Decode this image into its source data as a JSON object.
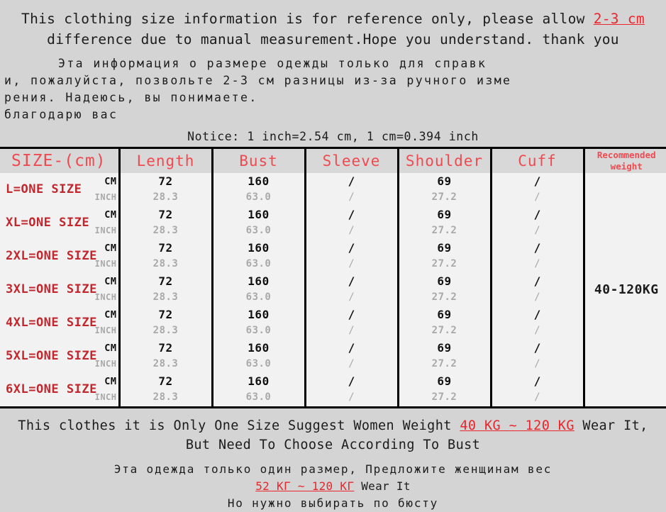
{
  "intro_en": {
    "text_before": "This clothing size information is for reference only, please allow ",
    "highlight": "2-3 cm",
    "text_after": " difference due to manual measurement.Hope you understand. thank you"
  },
  "intro_ru": {
    "line1": "Эта информация о размере одежды только для справк",
    "line2": "и, пожалуйста, позвольте 2-3 см разницы из-за ручного изме",
    "line3": "рения. Надеюсь, вы понимаете.",
    "line4": "благодарю вас"
  },
  "notice": "Notice: 1 inch=2.54 cm, 1 cm=0.394 inch",
  "table": {
    "headers": {
      "size": "SIZE-(cm)",
      "length": "Length",
      "bust": "Bust",
      "sleeve": "Sleeve",
      "shoulder": "Shoulder",
      "cuff": "Cuff",
      "weight_line1": "Recommended",
      "weight_line2": "weight"
    },
    "unit_cm": "CM",
    "unit_inch": "INCH",
    "weight_value": "40-120KG",
    "rows": [
      {
        "size": "L=ONE SIZE",
        "length_cm": "72",
        "length_inch": "28.3",
        "bust_cm": "160",
        "bust_inch": "63.0",
        "sleeve_cm": "/",
        "sleeve_inch": "/",
        "shoulder_cm": "69",
        "shoulder_inch": "27.2",
        "cuff_cm": "/",
        "cuff_inch": "/"
      },
      {
        "size": "XL=ONE SIZE",
        "length_cm": "72",
        "length_inch": "28.3",
        "bust_cm": "160",
        "bust_inch": "63.0",
        "sleeve_cm": "/",
        "sleeve_inch": "/",
        "shoulder_cm": "69",
        "shoulder_inch": "27.2",
        "cuff_cm": "/",
        "cuff_inch": "/"
      },
      {
        "size": "2XL=ONE SIZE",
        "length_cm": "72",
        "length_inch": "28.3",
        "bust_cm": "160",
        "bust_inch": "63.0",
        "sleeve_cm": "/",
        "sleeve_inch": "/",
        "shoulder_cm": "69",
        "shoulder_inch": "27.2",
        "cuff_cm": "/",
        "cuff_inch": "/"
      },
      {
        "size": "3XL=ONE SIZE",
        "length_cm": "72",
        "length_inch": "28.3",
        "bust_cm": "160",
        "bust_inch": "63.0",
        "sleeve_cm": "/",
        "sleeve_inch": "/",
        "shoulder_cm": "69",
        "shoulder_inch": "27.2",
        "cuff_cm": "/",
        "cuff_inch": "/"
      },
      {
        "size": "4XL=ONE SIZE",
        "length_cm": "72",
        "length_inch": "28.3",
        "bust_cm": "160",
        "bust_inch": "63.0",
        "sleeve_cm": "/",
        "sleeve_inch": "/",
        "shoulder_cm": "69",
        "shoulder_inch": "27.2",
        "cuff_cm": "/",
        "cuff_inch": "/"
      },
      {
        "size": "5XL=ONE SIZE",
        "length_cm": "72",
        "length_inch": "28.3",
        "bust_cm": "160",
        "bust_inch": "63.0",
        "sleeve_cm": "/",
        "sleeve_inch": "/",
        "shoulder_cm": "69",
        "shoulder_inch": "27.2",
        "cuff_cm": "/",
        "cuff_inch": "/"
      },
      {
        "size": "6XL=ONE SIZE",
        "length_cm": "72",
        "length_inch": "28.3",
        "bust_cm": "160",
        "bust_inch": "63.0",
        "sleeve_cm": "/",
        "sleeve_inch": "/",
        "shoulder_cm": "69",
        "shoulder_inch": "27.2",
        "cuff_cm": "/",
        "cuff_inch": "/"
      }
    ]
  },
  "footer_en": {
    "line1_before": "This clothes it is Only One Size Suggest Women Weight ",
    "line1_highlight": "40 KG ~ 120 KG",
    "line1_after": " Wear It,",
    "line2": "But Need To Choose According To Bust"
  },
  "footer_ru": {
    "line1": "Эта одежда только один размер, Предложите женщинам вес",
    "line2_highlight": "52 КГ ~ 120 КГ",
    "line2_after": "Wear It",
    "line3": "Но нужно выбирать по бюсту"
  },
  "colors": {
    "page_bg": "#d4d4d4",
    "table_bg": "#f2f2f2",
    "header_bg": "#d8d8d8",
    "header_red": "#ef4a50",
    "size_red": "#c1272d",
    "highlight_red": "#e8262c",
    "inch_gray": "#a9a9a9",
    "border": "#000000"
  }
}
